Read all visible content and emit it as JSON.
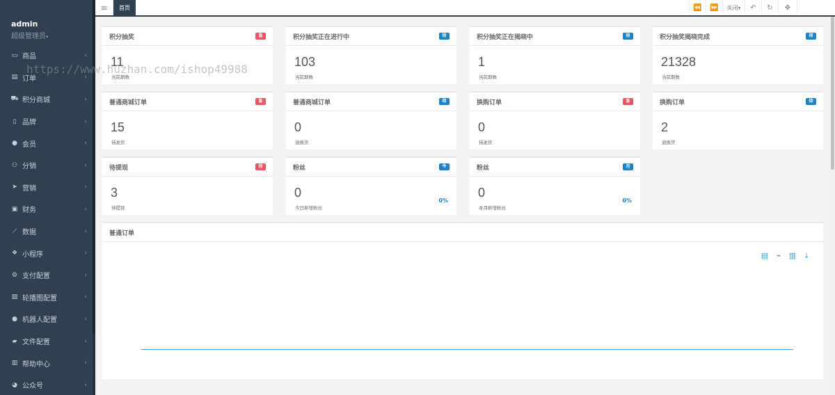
{
  "sidebar": {
    "user_name": "admin",
    "user_role": "超级管理员",
    "items": [
      {
        "label": "商品",
        "icon": "laptop-icon",
        "glyph": "▭"
      },
      {
        "label": "订单",
        "icon": "file-icon",
        "glyph": "▤"
      },
      {
        "label": "积分商城",
        "icon": "cart-icon",
        "glyph": "⛟"
      },
      {
        "label": "品牌",
        "icon": "tablet-icon",
        "glyph": "▯"
      },
      {
        "label": "会员",
        "icon": "user-icon",
        "glyph": "●"
      },
      {
        "label": "分销",
        "icon": "users-icon",
        "glyph": "⚇"
      },
      {
        "label": "营销",
        "icon": "send-icon",
        "glyph": "➤"
      },
      {
        "label": "财务",
        "icon": "money-icon",
        "glyph": "▣"
      },
      {
        "label": "数据",
        "icon": "line-chart-icon",
        "glyph": "⟋"
      },
      {
        "label": "小程序",
        "icon": "cubes-icon",
        "glyph": "❖"
      },
      {
        "label": "支付配置",
        "icon": "cogs-icon",
        "glyph": "⚙"
      },
      {
        "label": "轮播图配置",
        "icon": "image-icon",
        "glyph": "▨"
      },
      {
        "label": "机器人配置",
        "icon": "user-secret-icon",
        "glyph": "●"
      },
      {
        "label": "文件配置",
        "icon": "folder-icon",
        "glyph": "▰"
      },
      {
        "label": "帮助中心",
        "icon": "book-icon",
        "glyph": "▥"
      },
      {
        "label": "公众号",
        "icon": "wechat-icon",
        "glyph": "◕"
      }
    ]
  },
  "topbar": {
    "menu_glyph": "≡",
    "active_tab": "首页",
    "prev_glyph": "⏪",
    "next_glyph": "⏩",
    "close_label": "关闭▾",
    "back_glyph": "↶",
    "refresh_glyph": "↻",
    "fullscreen_glyph": "✥"
  },
  "watermark": "https://www.huzhan.com/ishop49988",
  "cards": [
    {
      "title": "积分抽奖",
      "badge": "急",
      "badge_color": "#ed5565",
      "value": "11",
      "sub": "当前期数",
      "pct": ""
    },
    {
      "title": "积分抽奖正在进行中",
      "badge": "待",
      "badge_color": "#1c84c6",
      "value": "103",
      "sub": "当前期数",
      "pct": ""
    },
    {
      "title": "积分抽奖正在揭晓中",
      "badge": "待",
      "badge_color": "#1c84c6",
      "value": "1",
      "sub": "当前期数",
      "pct": ""
    },
    {
      "title": "积分抽奖揭晓完成",
      "badge": "待",
      "badge_color": "#1c84c6",
      "value": "21328",
      "sub": "当前期数",
      "pct": ""
    },
    {
      "title": "普通商城订单",
      "badge": "急",
      "badge_color": "#ed5565",
      "value": "15",
      "sub": "待发货",
      "pct": ""
    },
    {
      "title": "普通商城订单",
      "badge": "待",
      "badge_color": "#1c84c6",
      "value": "0",
      "sub": "退换货",
      "pct": ""
    },
    {
      "title": "换购订单",
      "badge": "急",
      "badge_color": "#ed5565",
      "value": "0",
      "sub": "待发货",
      "pct": ""
    },
    {
      "title": "换购订单",
      "badge": "待",
      "badge_color": "#1c84c6",
      "value": "2",
      "sub": "退换货",
      "pct": ""
    },
    {
      "title": "待提现",
      "badge": "待",
      "badge_color": "#ed5565",
      "value": "3",
      "sub": "待提现",
      "pct": ""
    },
    {
      "title": "粉丝",
      "badge": "今",
      "badge_color": "#1c84c6",
      "value": "0",
      "sub": "今日新增粉丝",
      "pct": "0%"
    },
    {
      "title": "粉丝",
      "badge": "月",
      "badge_color": "#1c84c6",
      "value": "0",
      "sub": "本月新增粉丝",
      "pct": "0%"
    }
  ],
  "chart_panel": {
    "title": "普通订单",
    "toolbox": [
      {
        "icon": "data-view-icon",
        "glyph": "▤"
      },
      {
        "icon": "line-chart-icon",
        "glyph": "⌁"
      },
      {
        "icon": "bar-chart-icon",
        "glyph": "▥"
      },
      {
        "icon": "download-icon",
        "glyph": "⤓"
      }
    ]
  },
  "chart_data": {
    "type": "line",
    "title": "",
    "xlabel": "",
    "ylabel": "",
    "series": [
      {
        "values": [
          0,
          0
        ]
      }
    ]
  }
}
